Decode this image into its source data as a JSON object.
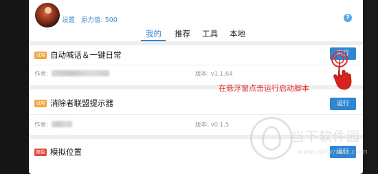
{
  "header": {
    "settings_label": "设置",
    "power_value": "原力值: 500",
    "help_icon_glyph": "?"
  },
  "tabs": [
    {
      "label": "我的",
      "active": true
    },
    {
      "label": "推荐",
      "active": false
    },
    {
      "label": "工具",
      "active": false
    },
    {
      "label": "本地",
      "active": false
    }
  ],
  "scripts": [
    {
      "badge": "试用",
      "badge_color": "#f0a640",
      "title": "自动喊话＆一键日常",
      "run_label": "运行",
      "author_label": "作者:",
      "version": "版本: v1.1.64"
    },
    {
      "badge": "试用",
      "badge_color": "#f0a640",
      "title": "消除者联盟提示器",
      "run_label": "运行",
      "author_label": "作者:",
      "version": "版本: v0.1.5"
    },
    {
      "badge": "限免",
      "badge_color": "#e24a3c",
      "title": "模拟位置",
      "run_label": "运行"
    }
  ],
  "annotation": "在悬浮窗点击运行启动脚本",
  "watermark": {
    "name": "当下软件园",
    "url": "www.downxia.com"
  },
  "colors": {
    "accent": "#2f86d2",
    "annotation": "#e0302b"
  }
}
